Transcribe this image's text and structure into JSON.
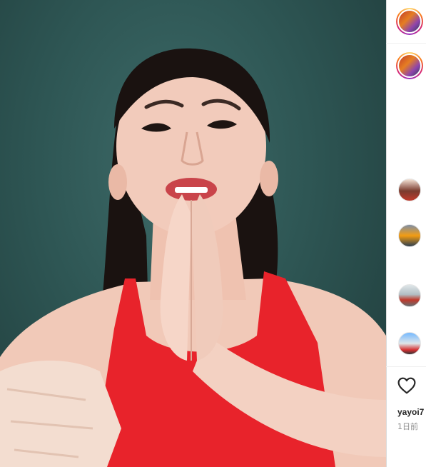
{
  "post": {
    "username": "yayoi7",
    "time_ago": "1日前"
  },
  "icons": {
    "like": "heart-icon"
  },
  "colors": {
    "top_color": "#e8232b",
    "story_ring": "#d62976",
    "background_wall": "#2e5654"
  }
}
